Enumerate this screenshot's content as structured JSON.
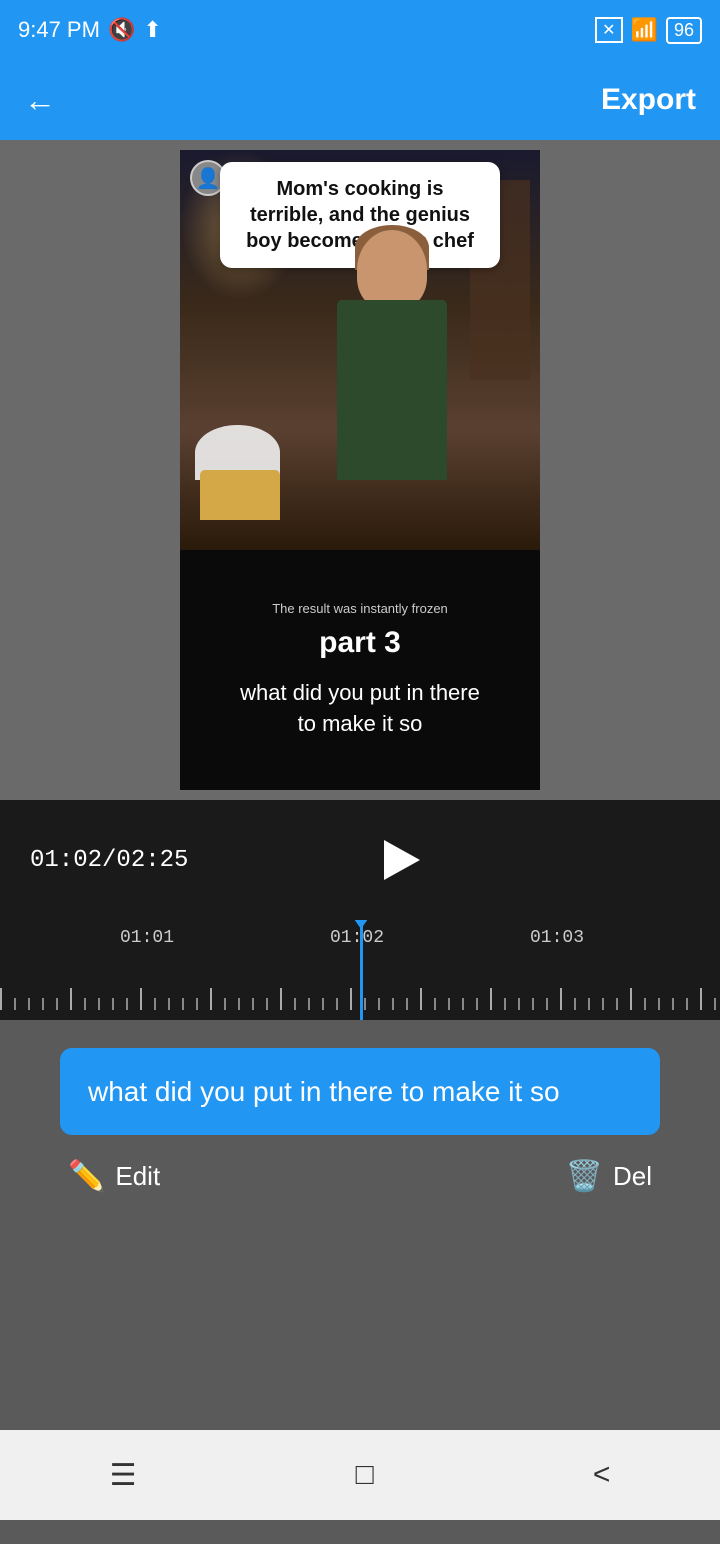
{
  "statusBar": {
    "time": "9:47 PM",
    "muteIcon": "🔇",
    "uploadIcon": "⬆",
    "batteryIcon": "96",
    "wifiIcon": "wifi"
  },
  "navBar": {
    "backLabel": "←",
    "exportLabel": "Export"
  },
  "videoPreview": {
    "titleBubble": "Mom's cooking is terrible, and the genius boy becomes a top chef",
    "subtitleSmall": "The result was instantly frozen",
    "partLabel": "part 3",
    "subtitleLarge": "what did you put in there\nto make it so"
  },
  "player": {
    "currentTime": "01:02",
    "totalTime": "02:25",
    "timeDisplay": "01:02/02:25"
  },
  "timeline": {
    "labels": [
      "01:01",
      "01:02",
      "01:03"
    ]
  },
  "caption": {
    "text": "what did you put in there to make it so",
    "editLabel": "Edit",
    "deleteLabel": "Del"
  },
  "bottomNav": {
    "menuIcon": "☰",
    "homeIcon": "□",
    "backIcon": "<"
  }
}
